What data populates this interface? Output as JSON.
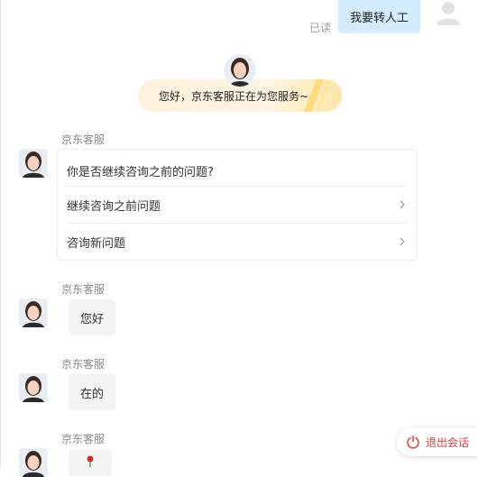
{
  "outgoing": {
    "text": "我要转人工",
    "status": "已读"
  },
  "welcome": {
    "text": "您好，京东客服正在为您服务~"
  },
  "agent_name": "京东客服",
  "question_card": {
    "title": "你是否继续咨询之前的问题?",
    "options": [
      {
        "label": "继续咨询之前问题"
      },
      {
        "label": "咨询新问题"
      }
    ]
  },
  "messages": [
    {
      "sender": "京东客服",
      "text": "您好"
    },
    {
      "sender": "京东客服",
      "text": "在的"
    },
    {
      "sender": "京东客服",
      "text": ""
    }
  ],
  "exit_button": {
    "label": "退出会话"
  },
  "colors": {
    "outgoing_bubble": "#d4ecff",
    "incoming_bubble": "#f3f3f3",
    "exit_text": "#e4393c",
    "banner": "#fff2dc"
  }
}
